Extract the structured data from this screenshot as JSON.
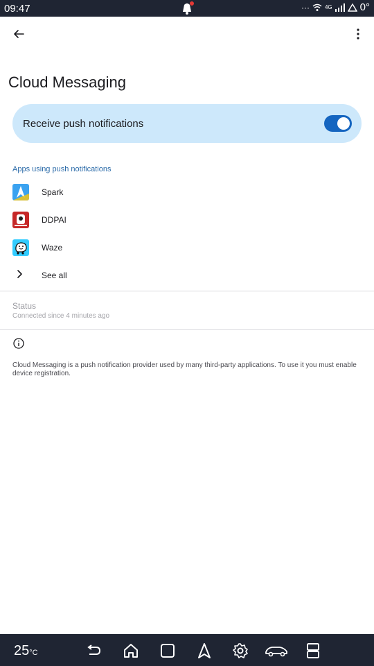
{
  "status_bar": {
    "time": "09:47",
    "network": "4G",
    "temperature": "0°"
  },
  "app": {
    "title": "Cloud Messaging",
    "toggle": {
      "label": "Receive push notifications",
      "on": true
    },
    "apps_section": {
      "header": "Apps using push notifications",
      "items": [
        {
          "name": "Spark",
          "icon": "spark-app-icon"
        },
        {
          "name": "DDPAI",
          "icon": "ddpai-app-icon"
        },
        {
          "name": "Waze",
          "icon": "waze-app-icon"
        }
      ],
      "see_all": "See all"
    },
    "status": {
      "title": "Status",
      "subtitle": "Connected since 4 minutes ago"
    },
    "info_text": "Cloud Messaging is a push notification provider used by many third-party applications. To use it you must enable device registration."
  },
  "nav_bar": {
    "temperature": "25",
    "unit": "°C"
  },
  "colors": {
    "system_bar": "#1f2533",
    "toggle_card": "#cde8fb",
    "accent": "#1565c0",
    "section_header": "#2a6aa8"
  }
}
